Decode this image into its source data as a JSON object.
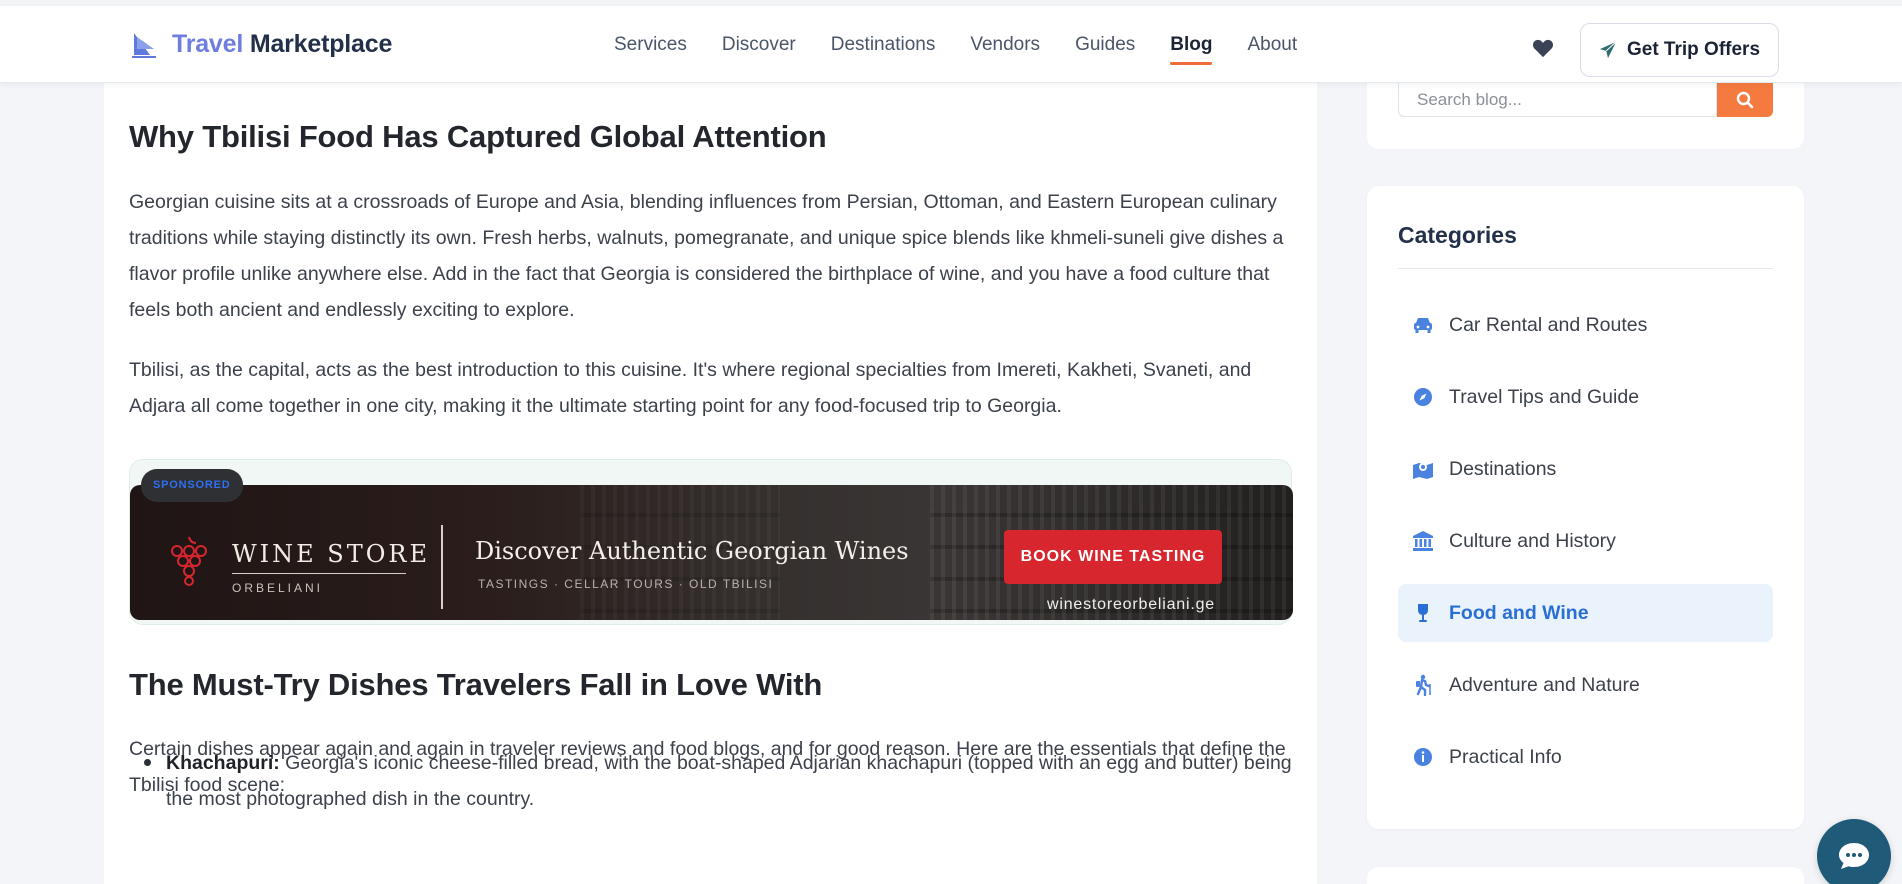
{
  "header": {
    "logo_word1": "Travel",
    "logo_word2": "Marketplace",
    "nav": [
      {
        "label": "Services"
      },
      {
        "label": "Discover"
      },
      {
        "label": "Destinations"
      },
      {
        "label": "Vendors"
      },
      {
        "label": "Guides"
      },
      {
        "label": "Blog",
        "active": true
      },
      {
        "label": "About"
      }
    ],
    "cta_label": "Get Trip Offers",
    "icons": {
      "wishlist": "heart-icon",
      "cta": "paper-plane-icon"
    }
  },
  "article": {
    "heading1": "Why Tbilisi Food Has Captured Global Attention",
    "para1": "Georgian cuisine sits at a crossroads of Europe and Asia, blending influences from Persian, Ottoman, and Eastern European culinary traditions while staying distinctly its own. Fresh herbs, walnuts, pomegranate, and unique spice blends like khmeli-suneli give dishes a flavor profile unlike anywhere else. Add in the fact that Georgia is considered the birthplace of wine, and you have a food culture that feels both ancient and endlessly exciting to explore.",
    "para2": "Tbilisi, as the capital, acts as the best introduction to this cuisine. It's where regional specialties from Imereti, Kakheti, Svaneti, and Adjara all come together in one city, making it the ultimate starting point for any food-focused trip to Georgia.",
    "heading2": "The Must-Try Dishes Travelers Fall in Love With",
    "para3": "Certain dishes appear again and again in traveler reviews and food blogs, and for good reason. Here are the essentials that define the Tbilisi food scene:",
    "list": [
      {
        "term": "Khachapuri:",
        "text": " Georgia's iconic cheese-filled bread, with the boat-shaped Adjarian khachapuri (topped with an egg and butter) being the most photographed dish in the country."
      }
    ]
  },
  "ad": {
    "badge": "SPONSORED",
    "brand": "WINE STORE",
    "brand_sub": "ORBELIANI",
    "headline": "Discover Authentic Georgian Wines",
    "tags": "TASTINGS  ·  CELLAR TOURS  ·  OLD TBILISI",
    "button": "BOOK WINE TASTING",
    "url": "winestoreorbeliani.ge"
  },
  "sidebar": {
    "search_placeholder": "Search blog...",
    "categories_title": "Categories",
    "categories": [
      {
        "label": "Car Rental and Routes",
        "icon": "car-icon"
      },
      {
        "label": "Travel Tips and Guide",
        "icon": "compass-icon"
      },
      {
        "label": "Destinations",
        "icon": "map-pin-icon"
      },
      {
        "label": "Culture and History",
        "icon": "landmark-icon"
      },
      {
        "label": "Food and Wine",
        "icon": "wine-glass-icon",
        "active": true
      },
      {
        "label": "Adventure and Nature",
        "icon": "hiking-icon"
      },
      {
        "label": "Practical Info",
        "icon": "info-icon"
      }
    ]
  },
  "colors": {
    "accent": "#f06b3a",
    "link_active": "#2a6fd6",
    "ad_button": "#d7262d",
    "chat": "#1f5a78"
  }
}
